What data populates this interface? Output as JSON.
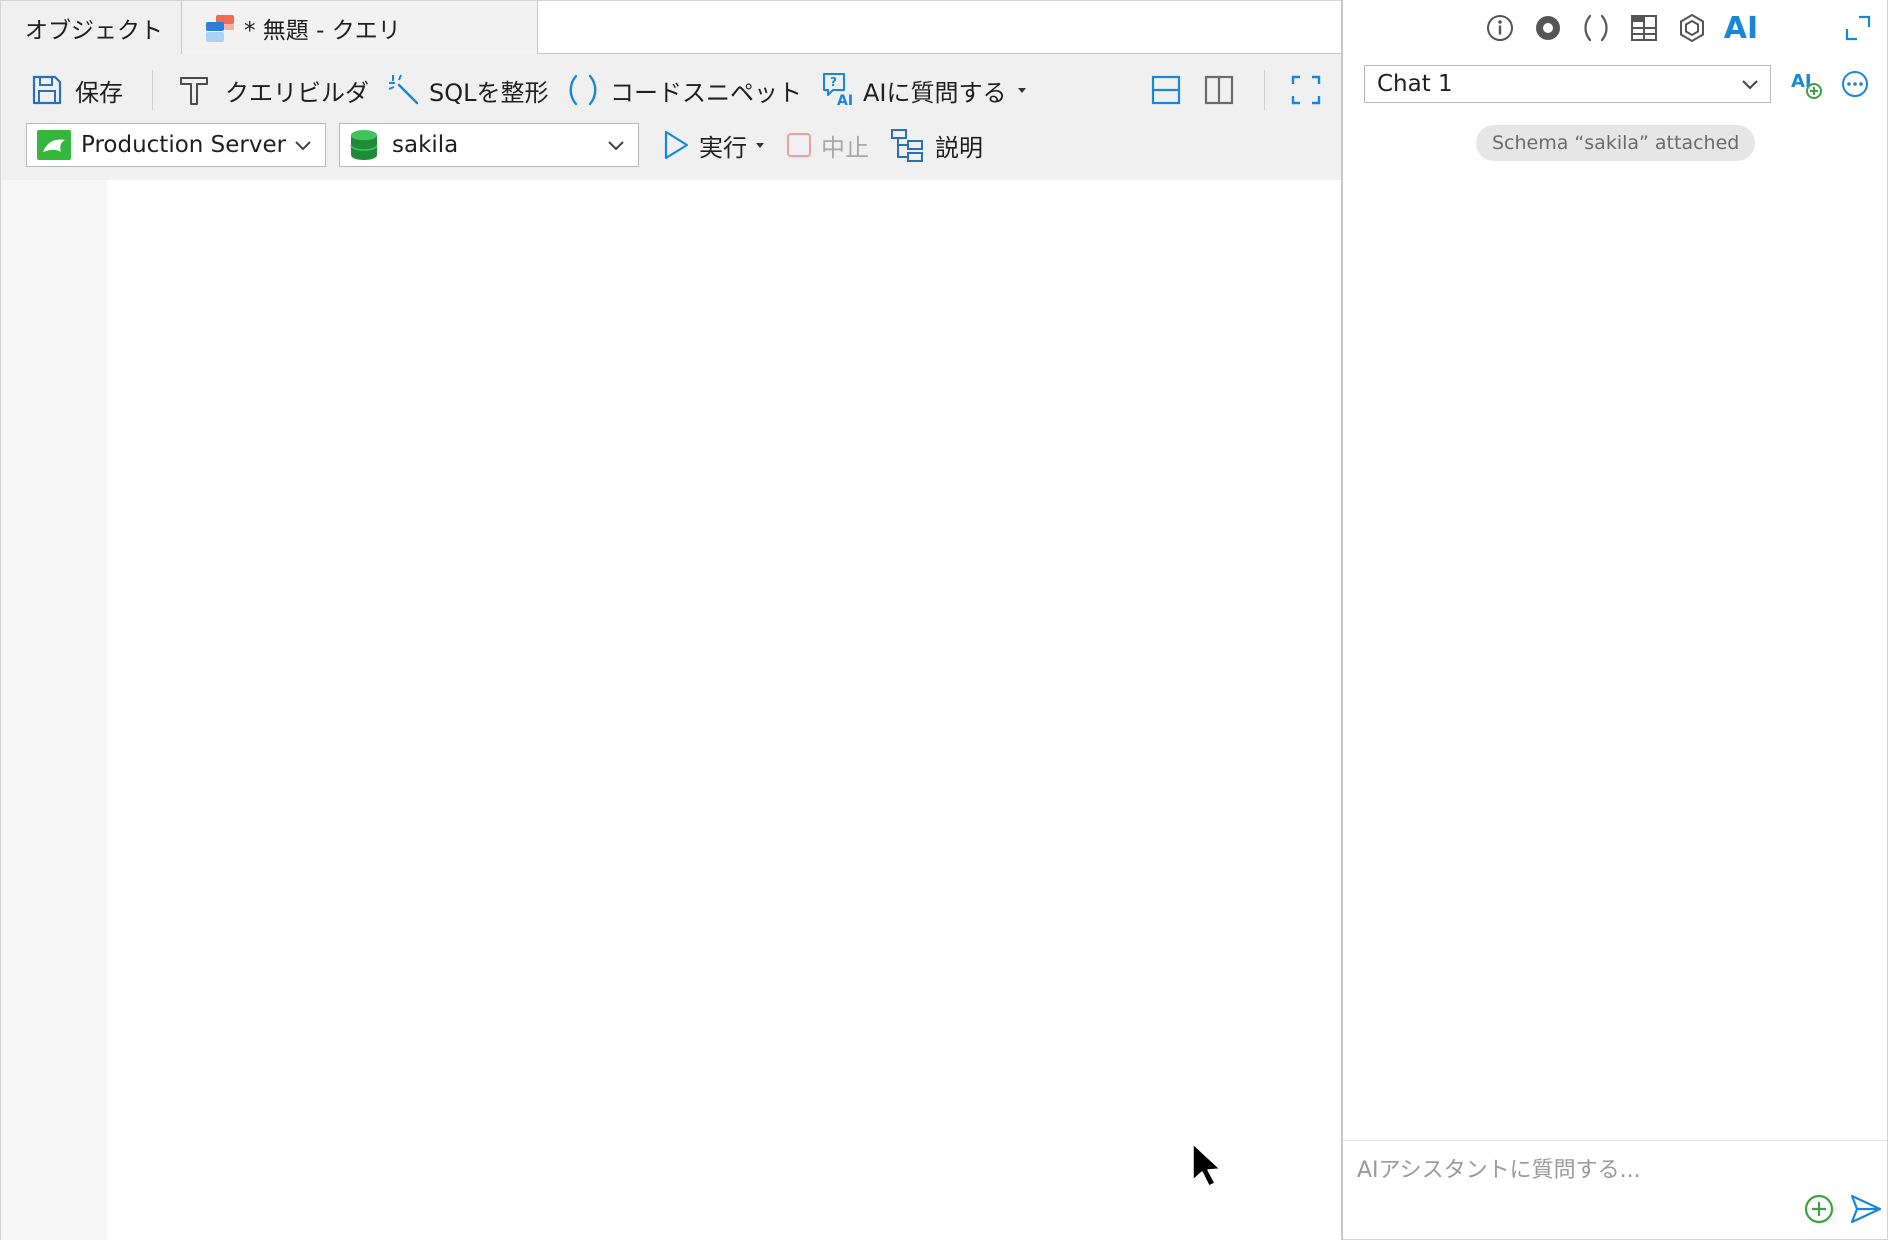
{
  "tabs": {
    "objects_label": "オブジェクト",
    "query_label": "* 無題 - クエリ"
  },
  "toolbar": {
    "save_label": "保存",
    "query_builder_label": "クエリビルダ",
    "beautify_sql_label": "SQLを整形",
    "code_snippet_label": "コードスニペット",
    "ask_ai_label": "AIに質問する",
    "run_label": "実行",
    "stop_label": "中止",
    "explain_label": "説明"
  },
  "connection": {
    "server_name": "Production Server",
    "database_name": "sakila"
  },
  "ai_panel": {
    "header_ai_label": "AI",
    "chat_selected": "Chat 1",
    "schema_chip": "Schema “sakila” attached",
    "composer_placeholder": "AIアシスタントに質問する..."
  },
  "colors": {
    "accent_blue": "#1a86d8",
    "toolbar_bg": "#f0f0f0",
    "server_green": "#35b63d",
    "db_green": "#1f8a3a",
    "add_green": "#3aa33f",
    "stop_red": "#e8a0a0"
  },
  "icons": {
    "save": "save-icon",
    "query_builder": "query-builder-icon",
    "beautify": "magic-wand-icon",
    "snippet": "parentheses-icon",
    "ask_ai": "ai-question-icon",
    "run": "play-icon",
    "stop": "stop-icon",
    "explain": "explain-tree-icon"
  }
}
